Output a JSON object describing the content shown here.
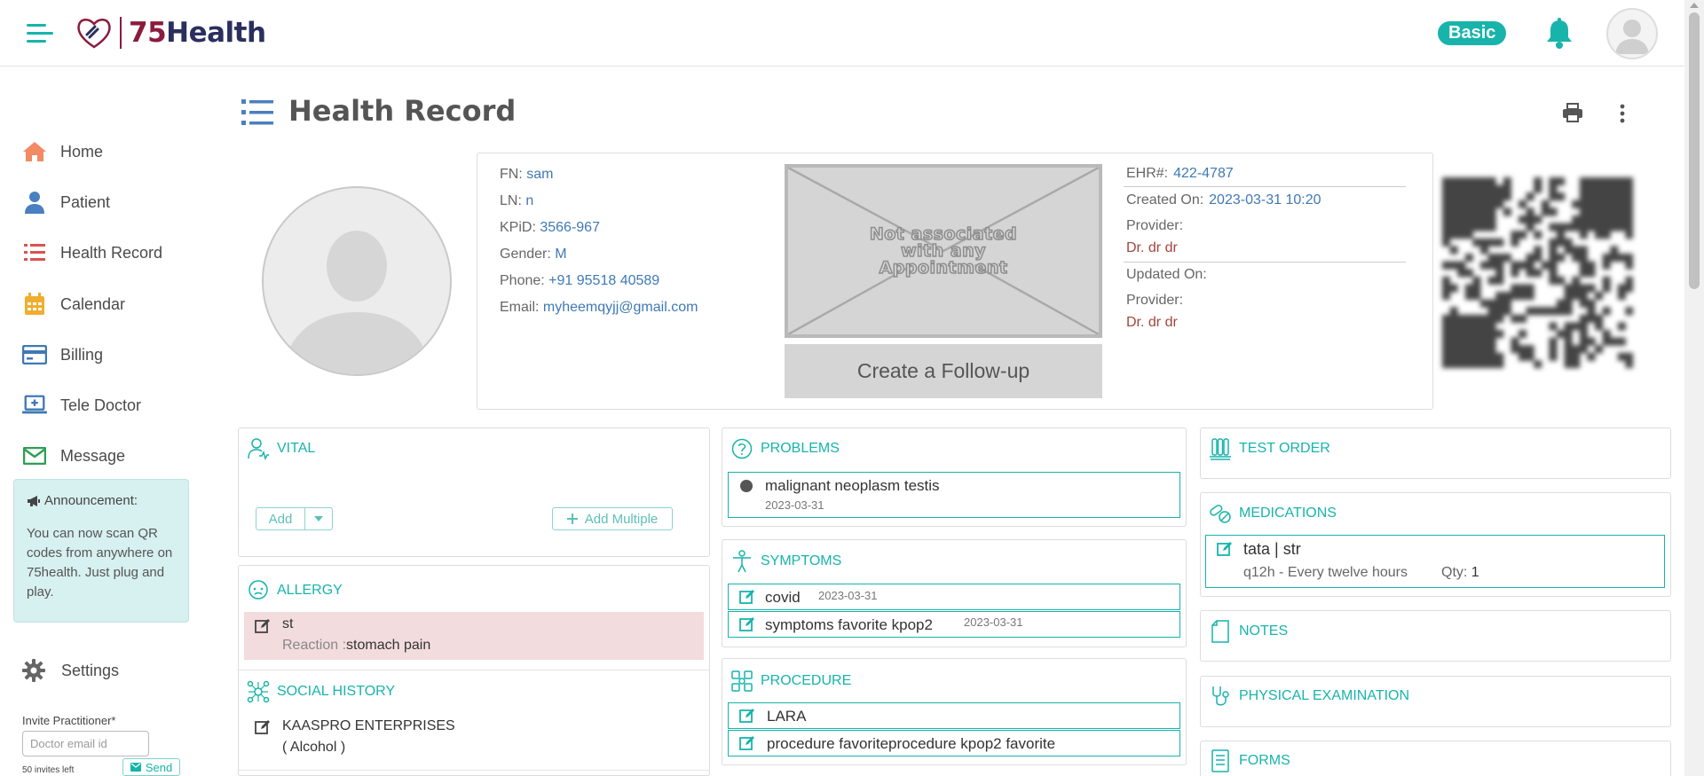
{
  "app": {
    "brand_number": "75",
    "brand_word": "Health",
    "plan_badge": "Basic"
  },
  "sidebar": {
    "items": [
      {
        "label": "Home",
        "icon": "home-icon",
        "color": "#f28a63"
      },
      {
        "label": "Patient",
        "icon": "user-icon",
        "color": "#4a7fc1"
      },
      {
        "label": "Health Record",
        "icon": "list-icon",
        "color": "#d9534f"
      },
      {
        "label": "Calendar",
        "icon": "calendar-icon",
        "color": "#f0ad2e"
      },
      {
        "label": "Billing",
        "icon": "credit-card-icon",
        "color": "#3f79b5"
      },
      {
        "label": "Tele Doctor",
        "icon": "laptop-icon",
        "color": "#3f79b5"
      },
      {
        "label": "Message",
        "icon": "envelope-icon",
        "color": "#2f9e55"
      }
    ],
    "announcement": {
      "title": "Announcement:",
      "body": "You can now scan QR codes from anywhere on 75health. Just plug and play."
    },
    "settings_label": "Settings",
    "invite": {
      "label": "Invite Practitioner*",
      "placeholder": "Doctor email id",
      "value": "",
      "invites_left": "50 invites left",
      "send_label": "Send"
    }
  },
  "page": {
    "title": "Health Record"
  },
  "patient": {
    "fn_label": "FN:",
    "fn": "sam",
    "ln_label": "LN:",
    "ln": "n",
    "kpid_label": "KPiD:",
    "kpid": "3566-967",
    "gender_label": "Gender:",
    "gender": "M",
    "phone_label": "Phone:",
    "phone": "+91 95518 40589",
    "email_label": "Email:",
    "email": "myheemqyjj@gmail.com"
  },
  "appointment": {
    "placeholder_line1": "Not associated",
    "placeholder_line2": "with any",
    "placeholder_line3": "Appointment",
    "followup_label": "Create a Follow-up"
  },
  "record_meta": {
    "ehr_label": "EHR#:",
    "ehr": "422-4787",
    "created_label": "Created On:",
    "created": "2023-03-31 10:20",
    "provider_label": "Provider:",
    "created_provider": "Dr. dr dr",
    "updated_label": "Updated On:",
    "updated": "",
    "updated_provider": "Dr. dr dr"
  },
  "sections": {
    "vital": {
      "title": "VITAL",
      "add_label": "Add",
      "add_multiple_label": "Add Multiple"
    },
    "allergy": {
      "title": "ALLERGY",
      "items": [
        {
          "name": "st",
          "reaction_label": "Reaction :",
          "reaction": "stomach pain"
        }
      ]
    },
    "social_history": {
      "title": "SOCIAL HISTORY",
      "items": [
        {
          "name": "KAASPRO ENTERPRISES",
          "detail": "( Alcohol )"
        }
      ]
    },
    "problems": {
      "title": "PROBLEMS",
      "items": [
        {
          "name": "malignant neoplasm testis",
          "date": "2023-03-31"
        }
      ]
    },
    "symptoms": {
      "title": "SYMPTOMS",
      "items": [
        {
          "name": "covid",
          "date": "2023-03-31"
        },
        {
          "name": "symptoms favorite kpop2",
          "date": "2023-03-31"
        }
      ]
    },
    "procedure": {
      "title": "PROCEDURE",
      "items": [
        {
          "name": "LARA"
        },
        {
          "name": "procedure favoriteprocedure kpop2 favorite"
        }
      ]
    },
    "test_order": {
      "title": "TEST ORDER"
    },
    "medications": {
      "title": "MEDICATIONS",
      "items": [
        {
          "name": "tata | str",
          "frequency": "q12h - Every twelve hours",
          "qty_label": "Qty:",
          "qty": "1"
        }
      ]
    },
    "notes": {
      "title": "NOTES"
    },
    "physical_examination": {
      "title": "PHYSICAL EXAMINATION"
    },
    "forms": {
      "title": "FORMS"
    }
  },
  "colors": {
    "accent": "#17b4ab",
    "link": "#3f79b5",
    "provider": "#a3453a",
    "brand_red": "#8b1b3d",
    "brand_navy": "#2b2f5e"
  }
}
